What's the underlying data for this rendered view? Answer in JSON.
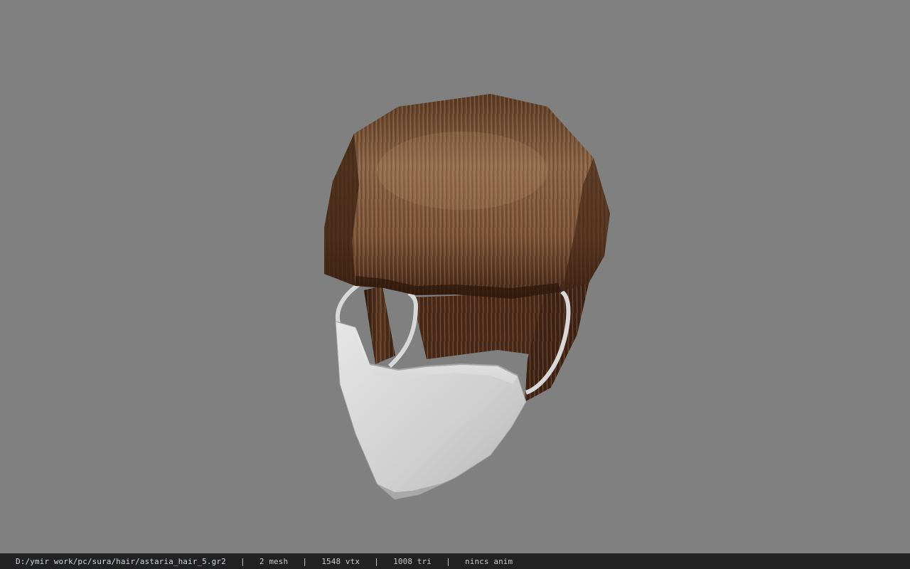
{
  "viewport": {
    "background_color": "#808080",
    "model_icon": "hair-mesh-with-face-mask"
  },
  "status_bar": {
    "file_path": "D:/ymir work/pc/sura/hair/astaria_hair_5.gr2",
    "mesh_count": "2 mesh",
    "vertex_count": "1548 vtx",
    "triangle_count": "1008 tri",
    "animation": "nincs anim",
    "separator": "|",
    "background_color": "#222222"
  }
}
